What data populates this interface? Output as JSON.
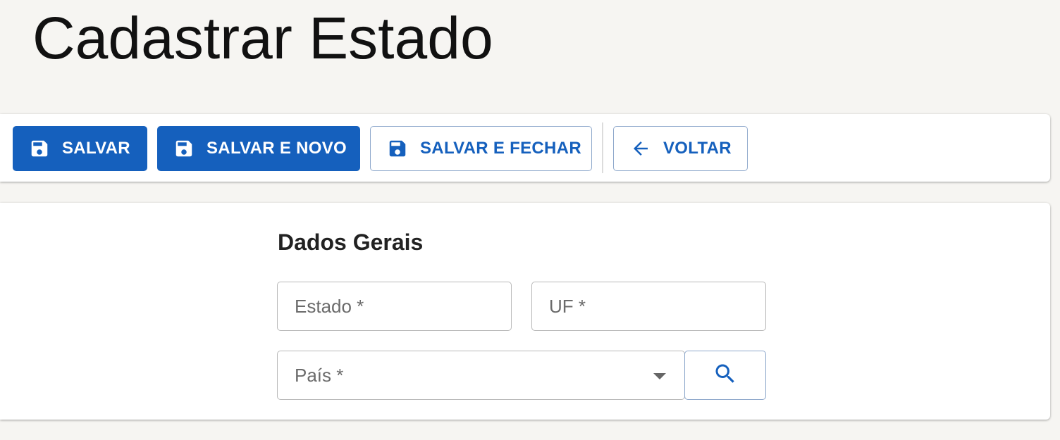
{
  "page": {
    "title": "Cadastrar Estado"
  },
  "toolbar": {
    "save_label": "SALVAR",
    "save_and_new_label": "SALVAR E NOVO",
    "save_and_close_label": "SALVAR E FECHAR",
    "back_label": "VOLTAR",
    "icons": {
      "save": "floppy-disk-icon",
      "back": "arrow-left-icon"
    }
  },
  "form": {
    "section_title": "Dados Gerais",
    "estado": {
      "placeholder": "Estado *",
      "value": ""
    },
    "uf": {
      "placeholder": "UF *",
      "value": ""
    },
    "pais": {
      "placeholder": "País *",
      "value": ""
    },
    "search_icon": "search-icon"
  },
  "colors": {
    "primary": "#1560bd",
    "background": "#f6f5f2",
    "card": "#ffffff"
  }
}
